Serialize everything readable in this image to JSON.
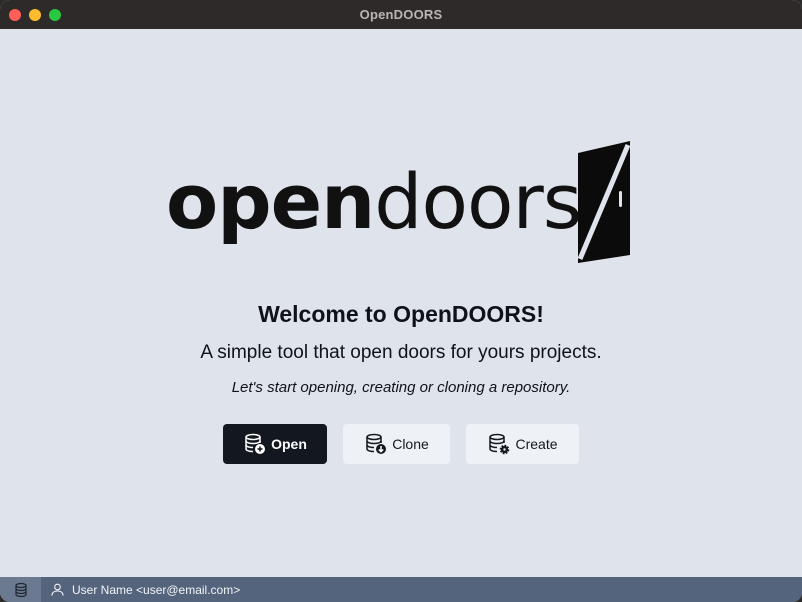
{
  "window": {
    "title": "OpenDOORS"
  },
  "logo": {
    "bold_text": "open",
    "light_text": "doors"
  },
  "welcome": {
    "heading": "Welcome to OpenDOORS!",
    "subtitle": "A simple tool that open doors for yours projects.",
    "hint": "Let's start opening, creating or cloning a repository."
  },
  "actions": {
    "open_label": "Open",
    "clone_label": "Clone",
    "create_label": "Create"
  },
  "statusbar": {
    "user": "User Name <user@email.com>"
  },
  "icons": {
    "open": "database-plus-icon",
    "clone": "database-download-icon",
    "create": "database-gear-icon",
    "status_db": "database-icon",
    "user": "user-icon"
  },
  "colors": {
    "background": "#dfe4ec",
    "primary_button": "#131720",
    "secondary_button": "#eef1f6",
    "statusbar": "#54647c"
  }
}
